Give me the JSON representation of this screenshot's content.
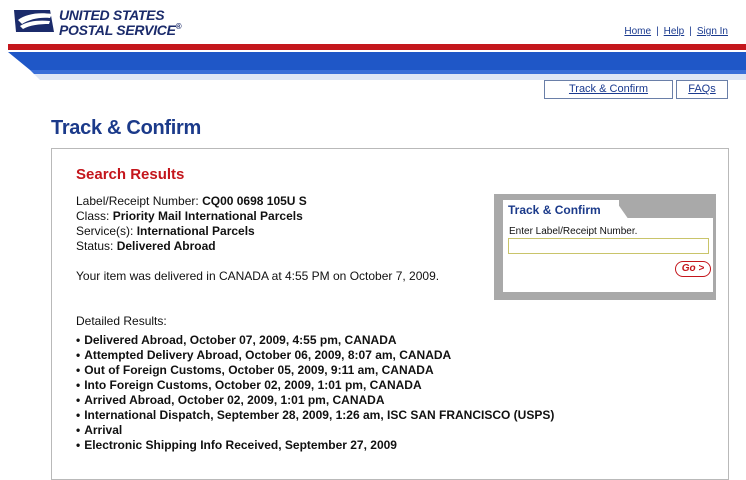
{
  "header": {
    "logo_line1": "UNITED STATES",
    "logo_line2": "POSTAL SERVICE",
    "logo_mark": "®",
    "links": [
      "Home",
      "Help",
      "Sign In"
    ],
    "separator": "|"
  },
  "colors": {
    "red_stripe": "#c4161c",
    "blue_stripe": "#1f57c7",
    "navy": "#1b3a8a",
    "title_red": "#c4161c"
  },
  "tabs": [
    "Track & Confirm",
    "FAQs"
  ],
  "page_title": "Track & Confirm",
  "results": {
    "heading": "Search Results",
    "label_prefix": "Label/Receipt Number: ",
    "label_value": "CQ00 0698 105U S",
    "class_prefix": "Class: ",
    "class_value": "Priority Mail International Parcels",
    "services_prefix": "Service(s): ",
    "services_value": "International Parcels",
    "status_prefix": "Status: ",
    "status_value": "Delivered Abroad",
    "delivery_message": "Your item was delivered in CANADA at 4:55 PM on October 7, 2009.",
    "detail_label": "Detailed Results:",
    "bullet": "•",
    "events": [
      "Delivered Abroad, October 07, 2009, 4:55 pm, CANADA",
      "Attempted Delivery Abroad, October 06, 2009, 8:07 am, CANADA",
      "Out of Foreign Customs, October 05, 2009, 9:11 am, CANADA",
      "Into Foreign Customs, October 02, 2009, 1:01 pm, CANADA",
      "Arrived Abroad, October 02, 2009, 1:01 pm, CANADA",
      "International Dispatch, September 28, 2009, 1:26 am, ISC SAN FRANCISCO (USPS)",
      "Arrival",
      "Electronic Shipping Info Received, September 27, 2009"
    ]
  },
  "widget": {
    "title": "Track & Confirm",
    "input_label": "Enter Label/Receipt Number.",
    "input_value": "",
    "go_label": "Go >"
  },
  "icons": {
    "logo": "usps-eagle-icon"
  }
}
